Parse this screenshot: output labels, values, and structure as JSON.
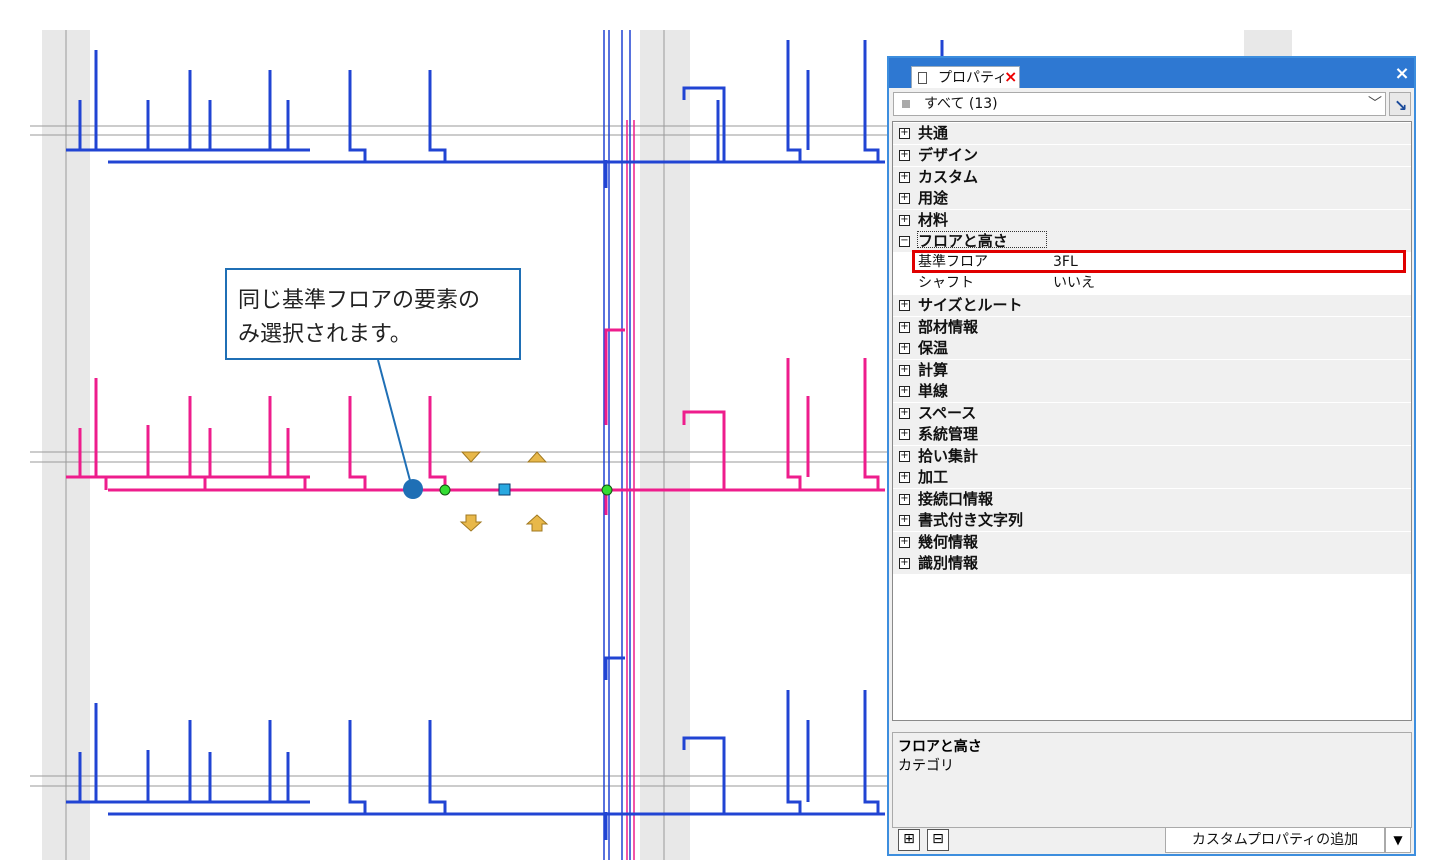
{
  "colors": {
    "blue_pipe": "#2144d3",
    "pink_pipe": "#ee1d8c",
    "panel_title": "#2e78d2",
    "highlight": "#e00000",
    "callout_border": "#1f6fb5"
  },
  "callout": {
    "line1": "同じ基準フロアの要素の",
    "line2": "み選択されます。"
  },
  "panel": {
    "tab_label": "プロパティ",
    "tab_close_icon": "×",
    "close_icon": "×",
    "filter_label": "すべて (13)",
    "categories": [
      {
        "label": "共通"
      },
      {
        "label": "デザイン"
      },
      {
        "label": "カスタム"
      },
      {
        "label": "用途"
      },
      {
        "label": "材料"
      },
      {
        "label": "フロアと高さ"
      },
      {
        "label": "サイズとルート"
      },
      {
        "label": "部材情報"
      },
      {
        "label": "保温"
      },
      {
        "label": "計算"
      },
      {
        "label": "単線"
      },
      {
        "label": "スペース"
      },
      {
        "label": "系統管理"
      },
      {
        "label": "拾い集計"
      },
      {
        "label": "加工"
      },
      {
        "label": "接続口情報"
      },
      {
        "label": "書式付き文字列"
      },
      {
        "label": "幾何情報"
      },
      {
        "label": "識別情報"
      }
    ],
    "properties": [
      {
        "name": "基準フロア",
        "value": "3FL"
      },
      {
        "name": "シャフト",
        "value": "いいえ"
      }
    ],
    "description": {
      "title": "フロアと高さ",
      "text": "カテゴリ"
    },
    "expand_all": "⊞",
    "collapse_all": "⊟",
    "add_button": "カスタムプロパティの追加",
    "add_dropdown": "▼"
  }
}
